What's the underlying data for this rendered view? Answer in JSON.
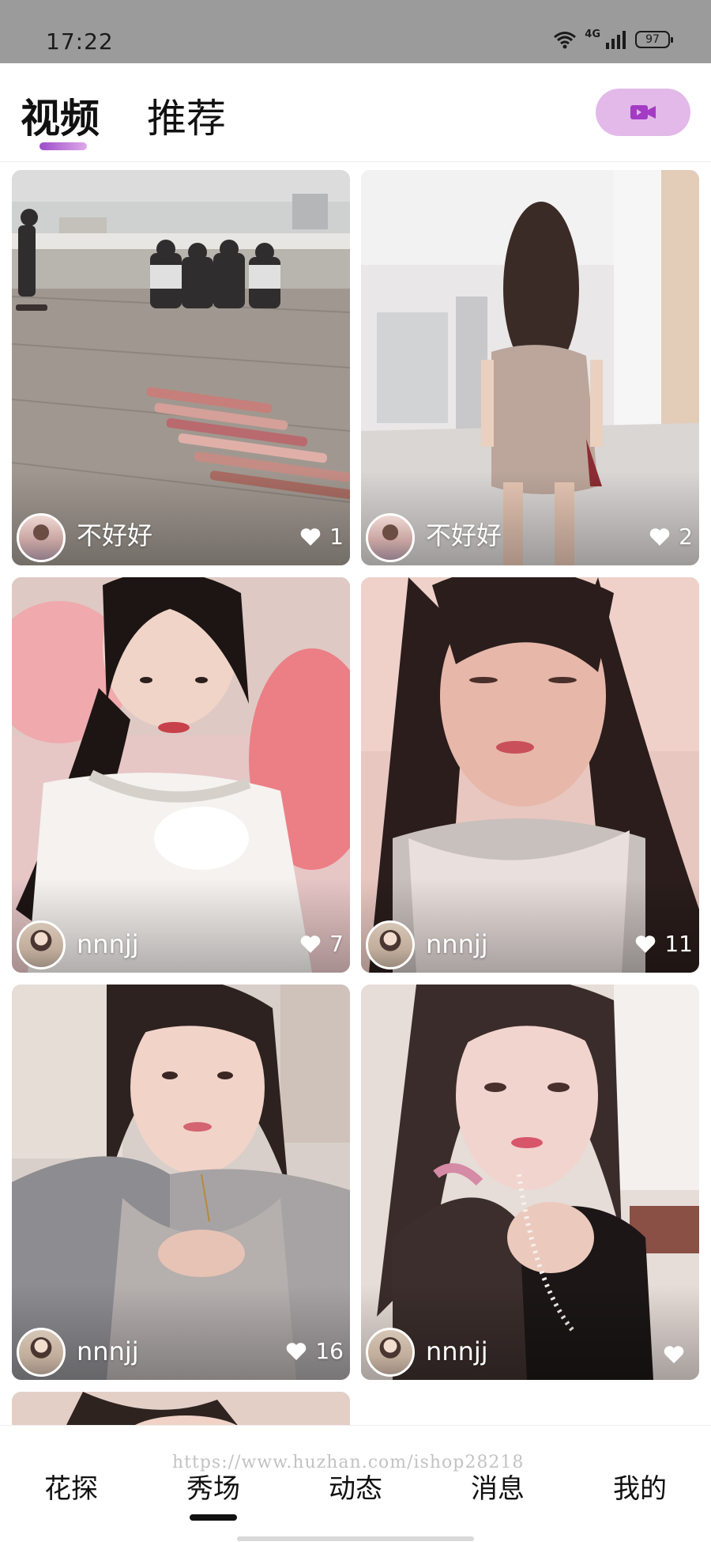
{
  "status_bar": {
    "time": "17:22",
    "network": "4G",
    "battery": "97"
  },
  "header": {
    "tabs": [
      {
        "label": "视频",
        "active": true
      },
      {
        "label": "推荐",
        "active": false
      }
    ],
    "record_icon": "video-camera-icon",
    "accent_color": "#9b4ec9",
    "record_button_color": "#e2b9e9"
  },
  "feed": {
    "cards": [
      {
        "username": "不好好",
        "likes": "1",
        "thumbnail": "skaters-on-bridge"
      },
      {
        "username": "不好好",
        "likes": "2",
        "thumbnail": "woman-in-hallway"
      },
      {
        "username": "nnnjj",
        "likes": "7",
        "thumbnail": "woman-selfie-pink-pillow"
      },
      {
        "username": "nnnjj",
        "likes": "11",
        "thumbnail": "woman-selfie-eyes-closed"
      },
      {
        "username": "nnnjj",
        "likes": "16",
        "thumbnail": "woman-selfie-grey-top"
      },
      {
        "username": "nnnjj",
        "likes": "",
        "thumbnail": "woman-selfie-pearl-necklace"
      }
    ],
    "like_icon": "heart-icon"
  },
  "bottom_nav": {
    "items": [
      {
        "label": "花探",
        "active": false
      },
      {
        "label": "秀场",
        "active": true
      },
      {
        "label": "动态",
        "active": false
      },
      {
        "label": "消息",
        "active": false
      },
      {
        "label": "我的",
        "active": false
      }
    ]
  },
  "watermark": "https://www.huzhan.com/ishop28218"
}
